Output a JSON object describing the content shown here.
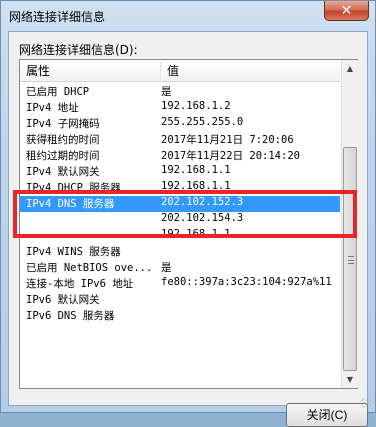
{
  "window": {
    "title": "网络连接详细信息",
    "close_glyph": "✕"
  },
  "group_label": "网络连接详细信息(D):",
  "columns": {
    "property": "属性",
    "value": "值"
  },
  "rows": [
    {
      "property": "已启用 DHCP",
      "value": "是"
    },
    {
      "property": "IPv4 地址",
      "value": "192.168.1.2"
    },
    {
      "property": "IPv4 子网掩码",
      "value": "255.255.255.0"
    },
    {
      "property": "获得租约的时间",
      "value": "2017年11月21日 7:20:06"
    },
    {
      "property": "租约过期的时间",
      "value": "2017年11月22日 20:14:20"
    },
    {
      "property": "IPv4 默认网关",
      "value": "192.168.1.1"
    },
    {
      "property": "IPv4 DHCP 服务器",
      "value": "192.168.1.1"
    },
    {
      "property": "IPv4 DNS 服务器",
      "value": "202.102.152.3",
      "selected": true
    },
    {
      "property": "",
      "value": "202.102.154.3"
    },
    {
      "property": "",
      "value": "192.168.1.1"
    },
    {
      "property": "IPv4 WINS 服务器",
      "value": ""
    },
    {
      "property": "已启用 NetBIOS ove...",
      "value": "是"
    },
    {
      "property": "连接-本地 IPv6 地址",
      "value": "fe80::397a:3c23:104:927a%11"
    },
    {
      "property": "IPv6 默认网关",
      "value": ""
    },
    {
      "property": "IPv6 DNS 服务器",
      "value": ""
    }
  ],
  "buttons": {
    "close_label": "关闭(C)"
  },
  "colors": {
    "selection": "#3399ff",
    "highlight_box": "#e8262a"
  }
}
